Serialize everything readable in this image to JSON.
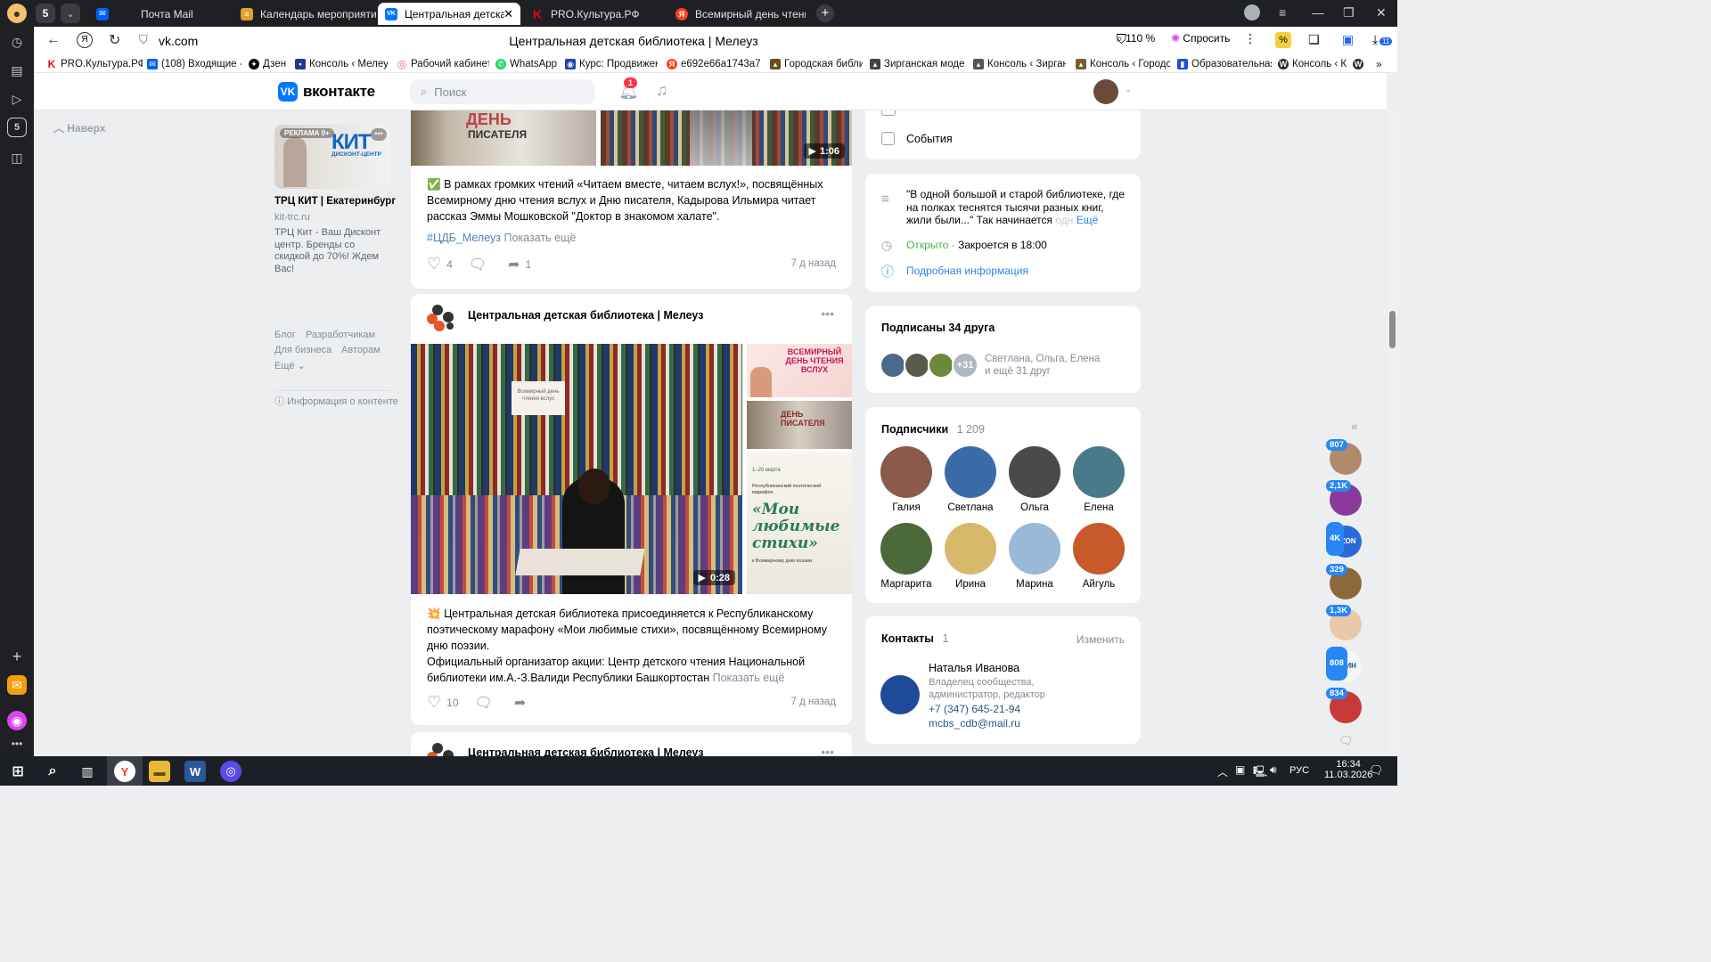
{
  "browser": {
    "tabs": [
      {
        "label": "Почта Mail",
        "color": "#005ff9",
        "glyph": "✉"
      },
      {
        "label": "Календарь мероприятий",
        "color": "#e3a12b",
        "glyph": "≡"
      },
      {
        "label": "Центральная детская б",
        "color": "#0077ff",
        "glyph": "VK",
        "active": true
      },
      {
        "label": "PRO.Культура.РФ",
        "color": "#e30613",
        "glyph": "K"
      },
      {
        "label": "Всемирный день чтения",
        "color": "#fc3f1d",
        "glyph": "Я"
      }
    ],
    "sidebar_tab_count": "5",
    "address": "vk.com",
    "page_title": "Центральная детская библиотека | Мелеуз",
    "zoom": "110 %",
    "ask": "Спросить",
    "ext_badge": "11",
    "bookmarks": [
      {
        "label": "PRO.Культура.РФ",
        "color": "#e30613",
        "glyph": "K"
      },
      {
        "label": "(108) Входящие -",
        "color": "#005ff9",
        "glyph": "✉"
      },
      {
        "label": "Дзен",
        "color": "#000000",
        "glyph": "✦"
      },
      {
        "label": "Консоль ‹ Мелеуз",
        "color": "#1e3a8a",
        "glyph": "▪"
      },
      {
        "label": "Рабочий кабинет",
        "color": "#ff5a5f",
        "glyph": "◎"
      },
      {
        "label": "WhatsApp",
        "color": "#25d366",
        "glyph": "✆"
      },
      {
        "label": "Курс: Продвижен",
        "color": "#1e40af",
        "glyph": "◉"
      },
      {
        "label": "e692e66a1743a76",
        "color": "#fc3f1d",
        "glyph": "Я"
      },
      {
        "label": "Городская библи",
        "color": "#6b4f1d",
        "glyph": "▴"
      },
      {
        "label": "Зирганская моде",
        "color": "#444444",
        "glyph": "▴"
      },
      {
        "label": "Консоль ‹ Зирган",
        "color": "#555555",
        "glyph": "▴"
      },
      {
        "label": "Консоль ‹ Городс",
        "color": "#7a5c2e",
        "glyph": "▴"
      },
      {
        "label": "Образовательная",
        "color": "#1d4ed8",
        "glyph": "▮"
      },
      {
        "label": "Консоль ‹ К",
        "color": "#2b2b2b",
        "glyph": "W"
      }
    ]
  },
  "vk": {
    "logo_text": "вконтакте",
    "search_placeholder": "Поиск",
    "notif_count": "1",
    "back_to_top": "Наверх"
  },
  "ad": {
    "label": "РЕКЛАМА 0+",
    "brand_big": "КИТ",
    "brand_small": "ДИСКОНТ-ЦЕНТР",
    "title": "ТРЦ КИТ | Екатеринбург",
    "domain": "kit-trc.ru",
    "text": "ТРЦ Кит - Ваш Дисконт центр. Бренды со скидкой до 70%! Ждем Вас!"
  },
  "footer_links": {
    "blog": "Блог",
    "dev": "Разработчикам",
    "biz": "Для бизнеса",
    "authors": "Авторам",
    "more": "Ещё",
    "content_info": "Информация о контенте"
  },
  "post1": {
    "banner_line1": "ДЕНЬ",
    "banner_line2": "ПИСАТЕЛЯ",
    "video_duration": "1:06",
    "emoji": "✅",
    "text": "В рамках громких чтений «Читаем вместе, читаем вслух!», посвящённых Всемирному дню чтения вслух и Дню писателя, Кадырова Ильмира читает рассказ Эммы Мошковской \"Доктор в знакомом халате\".",
    "hashtag": "#ЦДБ_Мелеуз",
    "show_more": "Показать ещё",
    "likes": "4",
    "reposts": "1",
    "time": "7 д назад"
  },
  "post2": {
    "author": "Центральная детская библиотека | Мелеуз",
    "video_duration": "0:28",
    "thumb1_text": "ВСЕМИРНЫЙ ДЕНЬ ЧТЕНИЯ ВСЛУХ",
    "thumb2_text": "ДЕНЬ ПИСАТЕЛЯ",
    "thumb3_dates": "1–20 марта",
    "thumb3_sub": "Республиканский поэтический марафон",
    "thumb3_title": "«Мои любимые стихи»",
    "thumb3_foot": "к Всемирному дню поэзии",
    "shelf_sign": "Всемирный день чтения вслух",
    "emoji": "💥",
    "text": "Центральная детская библиотека присоединяется к Республиканскому поэтическому марафону «Мои любимые стихи», посвящённому Всемирному дню поэзии.",
    "text2": "Официальный организатор акции: Центр детского чтения Национальной библиотеки им.А.-З.Валиди Республики Башкортостан",
    "show_more": "Показать ещё",
    "likes": "10",
    "time": "7 д назад"
  },
  "post3": {
    "author": "Центральная детская библиотека | Мелеуз"
  },
  "right": {
    "events": "События",
    "description": "\"В одной большой и старой библиотеке, где на полках теснятся тысячи разных книг, жили были...\" Так начинается",
    "description_fade": "одн",
    "more": "Ещё",
    "open": "Открыто",
    "closes": "Закроется в 18:00",
    "details": "Подробная информация",
    "friends_title": "Подписаны 34 друга",
    "friends_more": "+31",
    "friends_names": "Светлана, Ольга, Елена",
    "friends_rest": "и ещё 31 друг",
    "subs_title": "Подписчики",
    "subs_count": "1 209",
    "subs": [
      "Галия",
      "Светлана",
      "Ольга",
      "Елена",
      "Маргарита",
      "Ирина",
      "Марина",
      "Айгуль"
    ],
    "contacts_title": "Контакты",
    "contacts_count": "1",
    "contacts_edit": "Изменить",
    "contact_name": "Наталья Иванова",
    "contact_role": "Владелец сообщества, администратор, редактор",
    "contact_phone": "+7 (347) 645-21-94",
    "contact_email": "mcbs_cdb@mail.ru"
  },
  "messenger": [
    "807",
    "2,1K",
    "4K",
    "329",
    "1,3K",
    "808",
    "834"
  ],
  "messenger_labels": {
    "ozon": "OZON",
    "miin": "МИИН"
  },
  "taskbar": {
    "lang": "РУС",
    "time": "16:34",
    "date": "11.03.2026",
    "notif": "2"
  }
}
